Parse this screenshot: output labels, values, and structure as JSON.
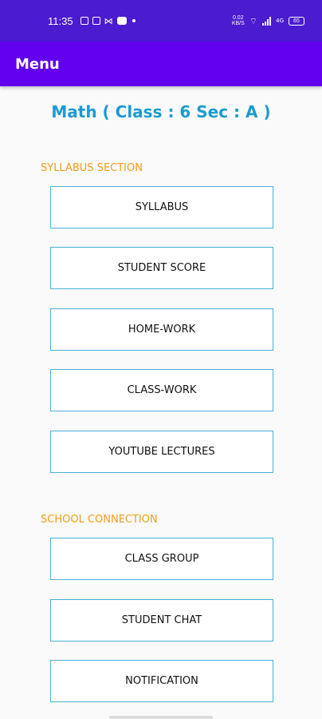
{
  "status_bar": {
    "time": "11:35",
    "net_speed_value": "0.02",
    "net_speed_unit": "KB/S",
    "network_label": "4G",
    "battery_level": "65"
  },
  "app_bar": {
    "title": "Menu"
  },
  "page": {
    "title": "Math ( Class : 6 Sec : A )"
  },
  "syllabus_section": {
    "header": "SYLLABUS SECTION",
    "buttons": [
      "SYLLABUS",
      "STUDENT SCORE",
      "HOME-WORK",
      "CLASS-WORK",
      "YOUTUBE LECTURES"
    ]
  },
  "school_connection": {
    "header": "SCHOOL CONNECTION",
    "buttons": [
      "CLASS GROUP",
      "STUDENT CHAT",
      "NOTIFICATION"
    ]
  },
  "colors": {
    "status_bar": "#4a1bcf",
    "app_bar": "#6200ee",
    "title": "#1a9bd1",
    "section_header": "#f29c1a",
    "button_border": "#4ab0d6"
  }
}
